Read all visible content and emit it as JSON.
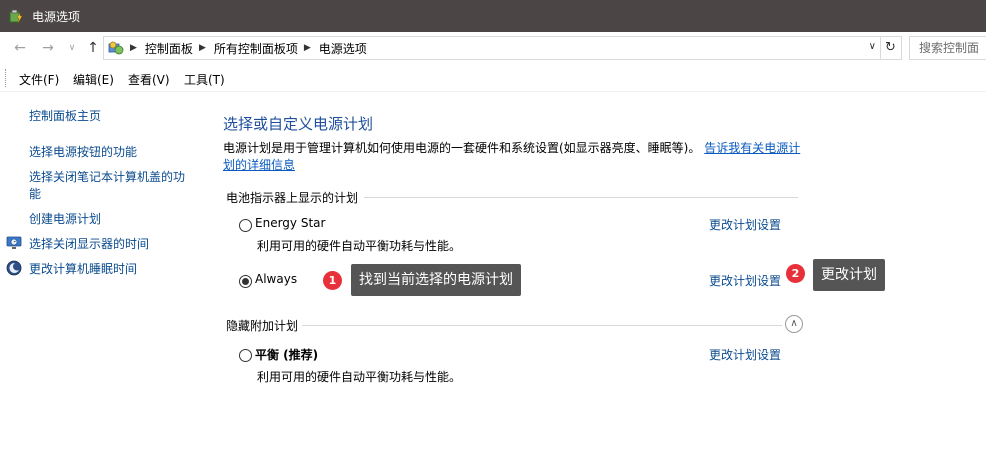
{
  "window": {
    "title": "电源选项"
  },
  "address": {
    "crumbs": [
      "控制面板",
      "所有控制面板项",
      "电源选项"
    ],
    "search_placeholder": "搜索控制面"
  },
  "menu": [
    "文件(F)",
    "编辑(E)",
    "查看(V)",
    "工具(T)"
  ],
  "leftnav": {
    "home": "控制面板主页",
    "links": [
      "选择电源按钮的功能",
      "选择关闭笔记本计算机盖的功",
      "能",
      "创建电源计划",
      "选择关闭显示器的时间",
      "更改计算机睡眠时间"
    ]
  },
  "main": {
    "title": "选择或自定义电源计划",
    "desc_text": "电源计划是用于管理计算机如何使用电源的一套硬件和系统设置(如显示器亮度、睡眠等)。",
    "desc_link_1": "告诉我有关电源计",
    "desc_link_2": "划的详细信息",
    "battery_group": "电池指示器上显示的计划",
    "hidden_group": "隐藏附加计划",
    "plans": [
      {
        "name": "Energy Star",
        "desc": "利用可用的硬件自动平衡功耗与性能。",
        "change": "更改计划设置",
        "selected": false
      },
      {
        "name": "Always",
        "desc": "",
        "change": "更改计划设置",
        "selected": true
      },
      {
        "name": "平衡 (推荐)",
        "desc": "利用可用的硬件自动平衡功耗与性能。",
        "change": "更改计划设置",
        "selected": false
      }
    ]
  },
  "annotations": [
    {
      "number": "1",
      "text": "找到当前选择的电源计划"
    },
    {
      "number": "2",
      "text": "更改计划"
    }
  ],
  "colors": {
    "titlebar": "#4b4645",
    "link": "#0b4b8f",
    "badge": "#e8303a",
    "tooltip": "#555555"
  },
  "icons": [
    "power-options-icon",
    "back-arrow-icon",
    "forward-arrow-icon",
    "recent-dropdown-icon",
    "up-arrow-icon",
    "control-panel-icon",
    "refresh-icon",
    "monitor-icon",
    "sleep-icon",
    "collapse-chevron-icon"
  ]
}
